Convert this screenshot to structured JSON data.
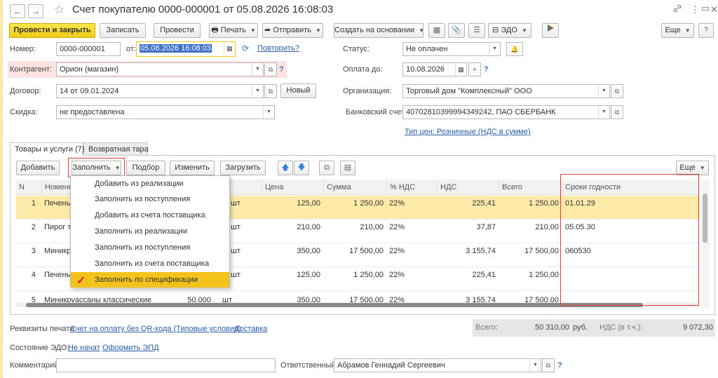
{
  "window": {
    "title": "Счет покупателю 0000-000001 от 05.08.2026 16:08:03",
    "back_glyph": "←",
    "forward_glyph": "→",
    "star_glyph": "☆",
    "link_glyph": "🔗",
    "more_glyph": "⋮",
    "restore_glyph": "▭",
    "close_glyph": "✕"
  },
  "toolbar": {
    "post_close": "Провести и закрыть",
    "save": "Записать",
    "post": "Провести",
    "print": "Печать",
    "send": "Отправить",
    "create_based": "Создать на основании",
    "edo": "ЭДО",
    "more": "Еще"
  },
  "form": {
    "number_label": "Номер:",
    "number_value": "0000-000001",
    "from_label": "от:",
    "date_value": "05.08.2026 16:08:03",
    "repeat_link": "Повторить?",
    "status_label": "Статус:",
    "status_value": "Не оплачен",
    "contractor_label": "Контрагент:",
    "contractor_value": "Орион (магазин)",
    "pay_until_label": "Оплата до:",
    "pay_until_value": "10.08.2026",
    "contract_label": "Договор:",
    "contract_value": "14 от 09.01.2024",
    "new_button": "Новый",
    "org_label": "Организация:",
    "org_value": "Торговый дом \"Комплексный\" ООО",
    "discount_label": "Скидка:",
    "discount_value": "не предоставлена",
    "bank_label": "Банковский счет:",
    "bank_value": "40702810399994349242, ПАО СБЕРБАНК",
    "price_type_link": "Тип цен: Розничные (НДС в сумме)",
    "question": "?"
  },
  "tabs": [
    {
      "label": "Товары и услуги (7)"
    },
    {
      "label": "Возвратная тара"
    }
  ],
  "table_toolbar": {
    "add": "Добавить",
    "fill": "Заполнить",
    "pick": "Подбор",
    "change": "Изменить",
    "load": "Загрузить",
    "more": "Еще"
  },
  "table": {
    "headers": [
      "N",
      "Номенклатура",
      "Цена",
      "Сумма",
      "% НДС",
      "НДС",
      "Всего",
      "Сроки годности"
    ],
    "rows": [
      {
        "n": "1",
        "name": "Печенье",
        "unit": "шт",
        "price": "125,00",
        "sum": "1 250,00",
        "vat_rate": "22%",
        "vat": "225,41",
        "total": "1 250,00",
        "expiry": "01.01.29"
      },
      {
        "n": "2",
        "name": "Пирог ти",
        "unit": "шт",
        "price": "210,00",
        "sum": "210,00",
        "vat_rate": "22%",
        "vat": "37,87",
        "total": "210,00",
        "expiry": "05.05.30"
      },
      {
        "n": "3",
        "name": "Миникру",
        "unit": "шт",
        "price": "350,00",
        "sum": "17 500,00",
        "vat_rate": "22%",
        "vat": "3 155,74",
        "total": "17 500,00",
        "expiry": "060530"
      },
      {
        "n": "4",
        "name": "Печенье",
        "unit": "шт",
        "price": "125,00",
        "sum": "1 250,00",
        "vat_rate": "22%",
        "vat": "225,41",
        "total": "1 250,00",
        "expiry": ""
      },
      {
        "n": "5",
        "name": "Миникруассаны классические",
        "unit": "шт",
        "qty": "50,000",
        "price": "350,00",
        "sum": "17 500,00",
        "vat_rate": "22%",
        "vat": "3 155,74",
        "total": "17 500,00",
        "expiry": ""
      }
    ]
  },
  "fill_menu": {
    "items": [
      "Добавить из реализации",
      "Заполнить из поступления",
      "Добавить из счета поставщика",
      "Заполнить из реализации",
      "Заполнить из поступления",
      "Заполнить из счета поставщика",
      "Заполнить по спецификации"
    ]
  },
  "footer": {
    "print_req_label": "Реквизиты печати:",
    "print_req_link": "Счет на оплату без QR-кода (Типовые условия)",
    "delivery_link": "Доставка",
    "total_label": "Всего:",
    "total_value": "50 310,00",
    "currency": "руб.",
    "vat_label": "НДС (в т.ч.):",
    "vat_value": "9 072,30",
    "edo_label": "Состояние ЭДО:",
    "edo_status_link": "Не начат",
    "edo_create_link": "Оформить ЭПД",
    "comment_label": "Комментарий:",
    "responsible_label": "Ответственный:",
    "responsible_value": "Абрамов Геннадий Сергеевич"
  },
  "colors": {
    "accent_yellow": "#f2cc14",
    "selected_row": "#fdeaa9",
    "annotation_red": "#e23a3a",
    "link_blue": "#2b5fa8"
  }
}
